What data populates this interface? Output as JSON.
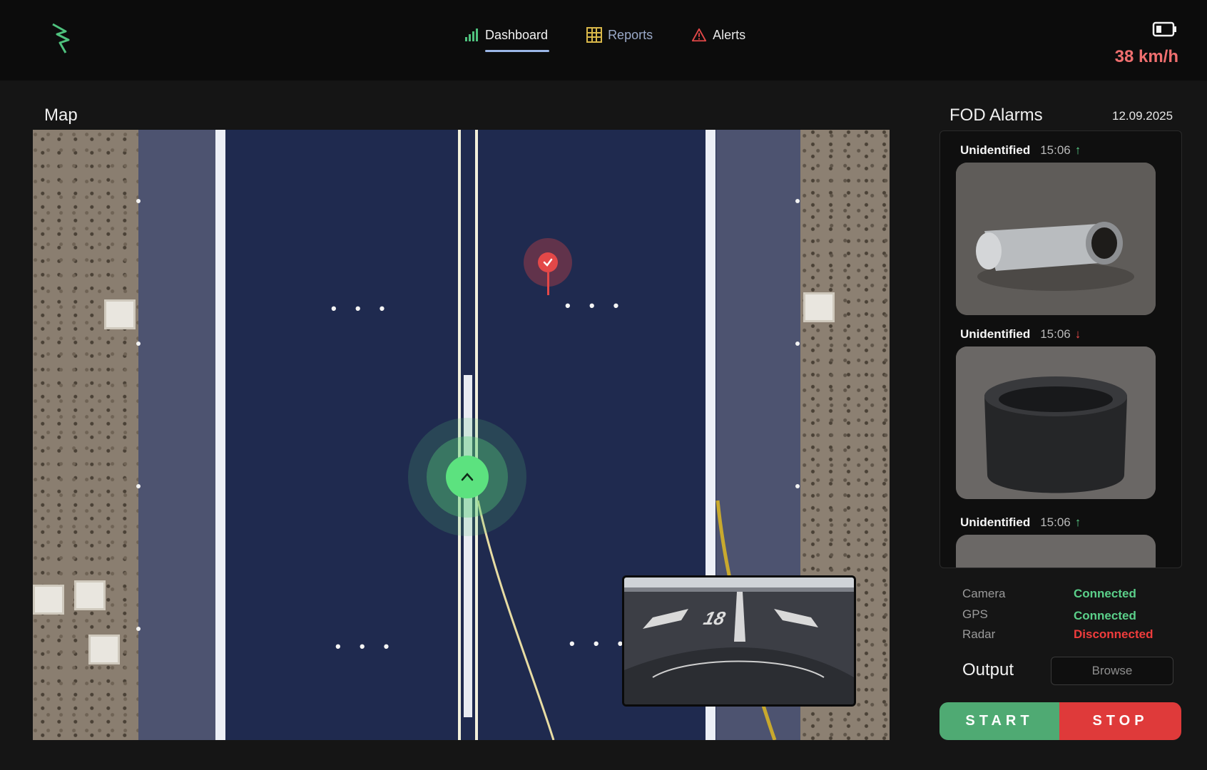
{
  "nav": {
    "items": [
      {
        "label": "Dashboard",
        "icon": "signal-bars-icon",
        "active": true
      },
      {
        "label": "Reports",
        "icon": "grid-icon",
        "active": false
      },
      {
        "label": "Alerts",
        "icon": "warning-icon",
        "active": false
      }
    ]
  },
  "header": {
    "speed": "38 km/h",
    "battery_icon": "battery-icon"
  },
  "map": {
    "title": "Map",
    "vehicle_icon": "chevron-up-icon",
    "pin_icon": "check-icon"
  },
  "camera": {
    "runway_number": "18"
  },
  "fod": {
    "title": "FOD Alarms",
    "date": "12.09.2025",
    "alarms": [
      {
        "label": "Unidentified",
        "time": "15:06",
        "direction": "↑",
        "object": "metal-cylinder"
      },
      {
        "label": "Unidentified",
        "time": "15:06",
        "direction": "↓",
        "object": "black-cylinder"
      },
      {
        "label": "Unidentified",
        "time": "15:06",
        "direction": "↑",
        "object": "unknown"
      }
    ]
  },
  "status": {
    "items": [
      {
        "label": "Camera",
        "value": "Connected",
        "ok": true
      },
      {
        "label": "GPS",
        "value": "Connected",
        "ok": true
      },
      {
        "label": "Radar",
        "value": "Disconnected",
        "ok": false
      }
    ]
  },
  "output": {
    "label": "Output",
    "browse_label": "Browse"
  },
  "controls": {
    "start_label": "START",
    "stop_label": "STOP"
  },
  "colors": {
    "accent_green": "#5bd08a",
    "alert_red": "#ef3c3c",
    "speed_color": "#ef6f6f"
  }
}
